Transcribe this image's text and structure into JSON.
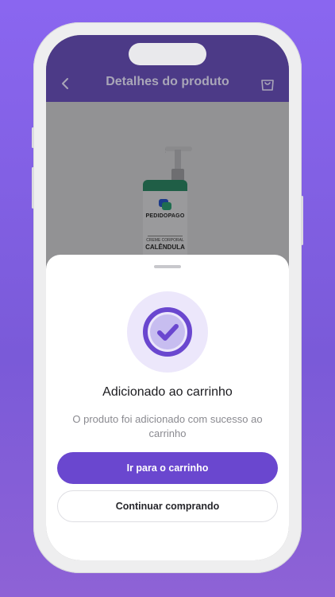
{
  "header": {
    "title": "Detalhes do produto",
    "back_icon": "chevron-left-icon",
    "cart_icon": "shopping-bag-icon"
  },
  "product": {
    "brand": "PEDIDOPAGO",
    "subtitle": "CREME CORPORAL",
    "name": "CALÊNDULA"
  },
  "sheet": {
    "title": "Adicionado ao carrinho",
    "description": "O produto foi adicionado com sucesso ao carrinho",
    "primary_button": "Ir para o carrinho",
    "secondary_button": "Continuar comprando",
    "success_icon": "check-circle-icon"
  },
  "colors": {
    "accent": "#6a47cf",
    "header": "#4c3a87",
    "background": "#8a66f0"
  }
}
